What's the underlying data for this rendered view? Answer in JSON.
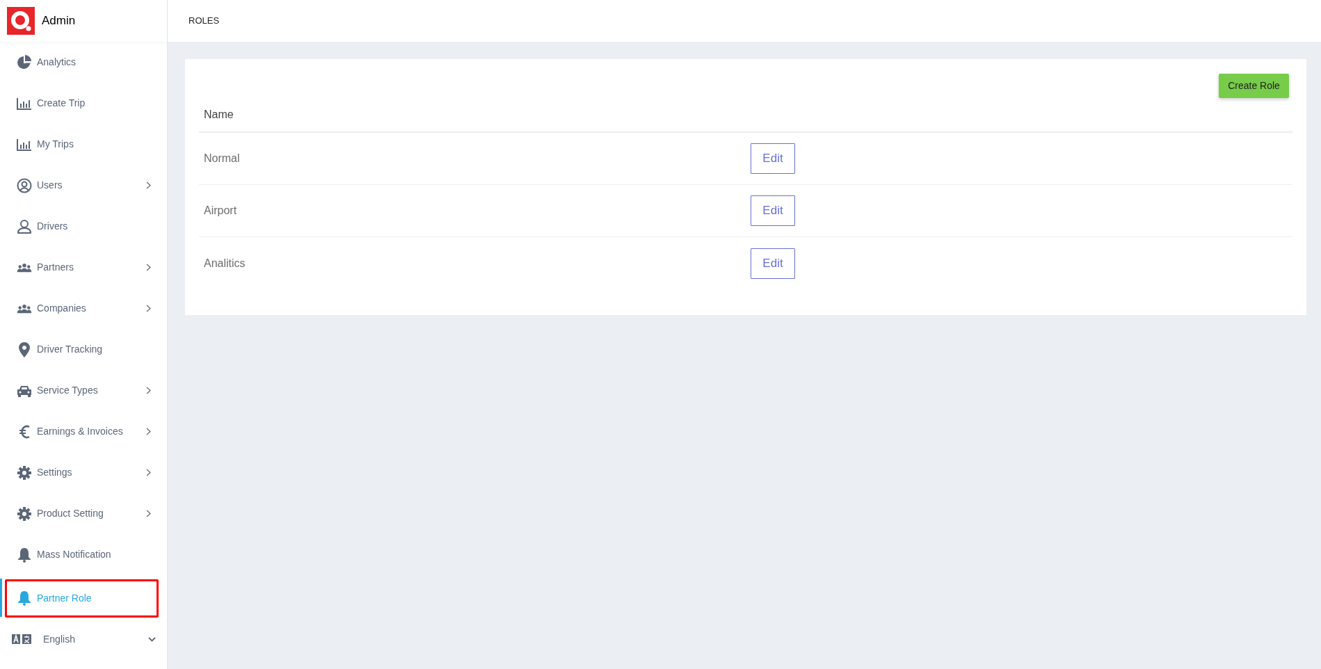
{
  "brand": {
    "title": "Admin"
  },
  "sidebar": {
    "items": [
      {
        "label": "Analytics",
        "has_submenu": false,
        "selected": false,
        "annotated": false
      },
      {
        "label": "Create Trip",
        "has_submenu": false,
        "selected": false,
        "annotated": false
      },
      {
        "label": "My Trips",
        "has_submenu": false,
        "selected": false,
        "annotated": false
      },
      {
        "label": "Users",
        "has_submenu": true,
        "selected": false,
        "annotated": false
      },
      {
        "label": "Drivers",
        "has_submenu": false,
        "selected": false,
        "annotated": false
      },
      {
        "label": "Partners",
        "has_submenu": true,
        "selected": false,
        "annotated": false
      },
      {
        "label": "Companies",
        "has_submenu": true,
        "selected": false,
        "annotated": false
      },
      {
        "label": "Driver Tracking",
        "has_submenu": false,
        "selected": false,
        "annotated": false
      },
      {
        "label": "Service Types",
        "has_submenu": true,
        "selected": false,
        "annotated": false
      },
      {
        "label": "Earnings & Invoices",
        "has_submenu": true,
        "selected": false,
        "annotated": false
      },
      {
        "label": "Settings",
        "has_submenu": true,
        "selected": false,
        "annotated": false
      },
      {
        "label": "Product Setting",
        "has_submenu": true,
        "selected": false,
        "annotated": false
      },
      {
        "label": "Mass Notification",
        "has_submenu": false,
        "selected": false,
        "annotated": false
      },
      {
        "label": "Partner Role",
        "has_submenu": false,
        "selected": true,
        "annotated": true
      }
    ],
    "language": {
      "value": "English"
    }
  },
  "page": {
    "title": "ROLES"
  },
  "card": {
    "create_button": "Create Role",
    "table": {
      "columns": [
        "Name"
      ],
      "rows": [
        {
          "name": "Normal",
          "action": "Edit"
        },
        {
          "name": "Airport",
          "action": "Edit"
        },
        {
          "name": "Analitics",
          "action": "Edit"
        }
      ]
    }
  }
}
